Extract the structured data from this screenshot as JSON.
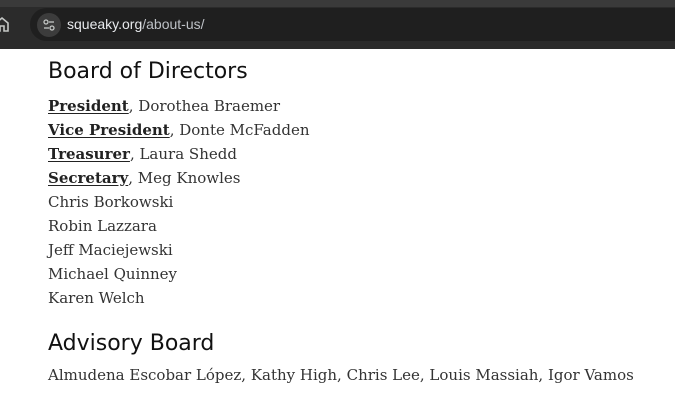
{
  "browser": {
    "url_domain": "squeaky.org",
    "url_path": "/about-us/"
  },
  "board": {
    "heading": "Board of Directors",
    "officers": [
      {
        "role": "President",
        "name": ", Dorothea Braemer"
      },
      {
        "role": "Vice President",
        "name": ", Donte McFadden"
      },
      {
        "role": "Treasurer",
        "name": ", Laura Shedd"
      },
      {
        "role": "Secretary",
        "name": ", Meg Knowles"
      }
    ],
    "members": [
      "Chris Borkowski",
      "Robin Lazzara",
      "Jeff Maciejewski",
      "Michael Quinney",
      "Karen Welch"
    ]
  },
  "advisory": {
    "heading": "Advisory Board",
    "members_text": "Almudena Escobar López, Kathy High, Chris Lee, Louis Massiah, Igor Vamos"
  }
}
